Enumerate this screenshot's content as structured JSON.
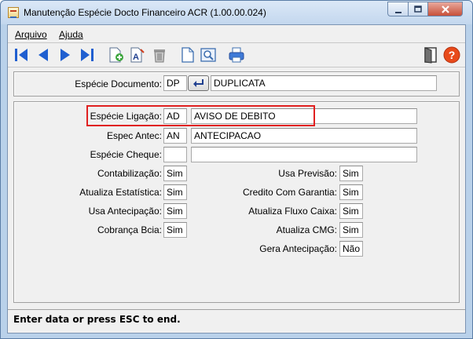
{
  "window": {
    "title": "Manutenção Espécie Docto Financeiro ACR (1.00.00.024)",
    "controls": [
      "minimize",
      "maximize",
      "close"
    ]
  },
  "menu": {
    "items": [
      {
        "label": "Arquivo"
      },
      {
        "label": "Ajuda"
      }
    ]
  },
  "toolbar": {
    "buttons": [
      {
        "icon": "first-record-icon"
      },
      {
        "icon": "previous-record-icon"
      },
      {
        "icon": "next-record-icon"
      },
      {
        "icon": "last-record-icon"
      },
      {
        "icon": "add-record-icon"
      },
      {
        "icon": "edit-record-icon"
      },
      {
        "icon": "delete-record-icon"
      },
      {
        "icon": "new-document-icon"
      },
      {
        "icon": "search-document-icon"
      },
      {
        "icon": "print-icon"
      },
      {
        "icon": "exit-door-icon"
      },
      {
        "icon": "help-icon"
      }
    ],
    "colors": {
      "nav": "#1f5fd0",
      "help": "#e84a1a"
    }
  },
  "header": {
    "especie_documento": {
      "label": "Espécie Documento:",
      "code": "DP",
      "description": "DUPLICATA"
    }
  },
  "form": {
    "especie_ligacao": {
      "label": "Espécie Ligação:",
      "code": "AD",
      "description": "AVISO DE DEBITO"
    },
    "espec_antec": {
      "label": "Espec Antec:",
      "code": "AN",
      "description": "ANTECIPACAO"
    },
    "especie_cheque": {
      "label": "Espécie Cheque:",
      "code": "",
      "description": ""
    },
    "left": [
      {
        "label": "Contabilização:",
        "value": "Sim"
      },
      {
        "label": "Atualiza Estatística:",
        "value": "Sim"
      },
      {
        "label": "Usa Antecipação:",
        "value": "Sim"
      },
      {
        "label": "Cobrança Bcia:",
        "value": "Sim"
      }
    ],
    "right": [
      {
        "label": "Usa Previsão:",
        "value": "Sim"
      },
      {
        "label": "Credito Com Garantia:",
        "value": "Sim"
      },
      {
        "label": "Atualiza Fluxo Caixa:",
        "value": "Sim"
      },
      {
        "label": "Atualiza CMG:",
        "value": "Sim"
      },
      {
        "label": "Gera Antecipação:",
        "value": "Não"
      }
    ]
  },
  "status": {
    "text": "Enter data or press ESC to end."
  },
  "highlight_color": "#e02020"
}
